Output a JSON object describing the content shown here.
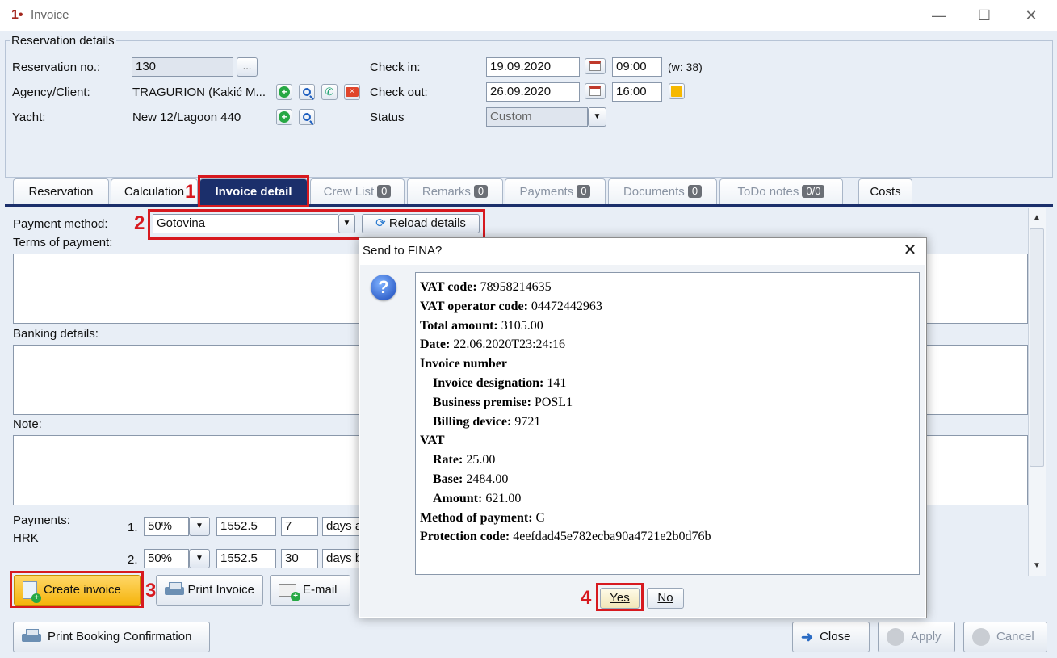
{
  "window": {
    "title": "Invoice",
    "minimize": "—",
    "maximize": "☐",
    "close": "✕"
  },
  "reservation": {
    "group_title": "Reservation details",
    "reservation_no_label": "Reservation no.:",
    "reservation_no": "130",
    "ellipsis": "...",
    "agency_label": "Agency/Client:",
    "agency_value": "TRAGURION (Kakić M...",
    "yacht_label": "Yacht:",
    "yacht_value": "New 12/Lagoon 440",
    "checkin_label": "Check in:",
    "checkin_date": "19.09.2020",
    "checkin_time": "09:00",
    "week": "(w: 38)",
    "checkout_label": "Check out:",
    "checkout_date": "26.09.2020",
    "checkout_time": "16:00",
    "status_label": "Status",
    "status_value": "Custom"
  },
  "tabs": [
    {
      "label": "Reservation"
    },
    {
      "label": "Calculation"
    },
    {
      "label": "Invoice detail"
    },
    {
      "label": "Crew List",
      "badge": "0"
    },
    {
      "label": "Remarks",
      "badge": "0"
    },
    {
      "label": "Payments",
      "badge": "0"
    },
    {
      "label": "Documents",
      "badge": "0"
    },
    {
      "label": "ToDo notes",
      "badge": "0/0"
    },
    {
      "label": "Costs"
    }
  ],
  "annotations": {
    "n1": "1",
    "n2": "2",
    "n3": "3",
    "n4": "4"
  },
  "invoice": {
    "payment_method_label": "Payment method:",
    "payment_method": "Gotovina",
    "reload_details": "Reload details",
    "terms_label": "Terms of payment:",
    "banking_label": "Banking details:",
    "note_label": "Note:",
    "payments_label": "Payments:",
    "currency": "HRK",
    "rows": [
      {
        "num": "1.",
        "percent": "50%",
        "amount": "1552.5",
        "days": "7",
        "unit": "days a"
      },
      {
        "num": "2.",
        "percent": "50%",
        "amount": "1552.5",
        "days": "30",
        "unit": "days b"
      }
    ],
    "create_invoice": "Create invoice",
    "print_invoice": "Print Invoice",
    "email": "E-mail"
  },
  "bottom": {
    "print_booking": "Print Booking Confirmation",
    "close": "Close",
    "apply": "Apply",
    "cancel": "Cancel"
  },
  "dialog": {
    "title": "Send to FINA?",
    "close": "✕",
    "vat_code_label": "VAT code:",
    "vat_code": "78958214635",
    "vat_operator_label": "VAT operator code:",
    "vat_operator": "04472442963",
    "total_label": "Total amount:",
    "total": "3105.00",
    "date_label": "Date:",
    "date": "22.06.2020T23:24:16",
    "invoice_number_label": "Invoice number",
    "designation_label": "Invoice designation:",
    "designation": "141",
    "premise_label": "Business premise:",
    "premise": "POSL1",
    "device_label": "Billing device:",
    "device": "9721",
    "vat_label": "VAT",
    "rate_label": "Rate:",
    "rate": "25.00",
    "base_label": "Base:",
    "base": "2484.00",
    "amount_label": "Amount:",
    "amount": "621.00",
    "method_label": "Method of payment:",
    "method": "G",
    "protection_label": "Protection code:",
    "protection": "4eefdad45e782ecba90a4721e2b0d76b",
    "yes": "Yes",
    "no": "No"
  }
}
